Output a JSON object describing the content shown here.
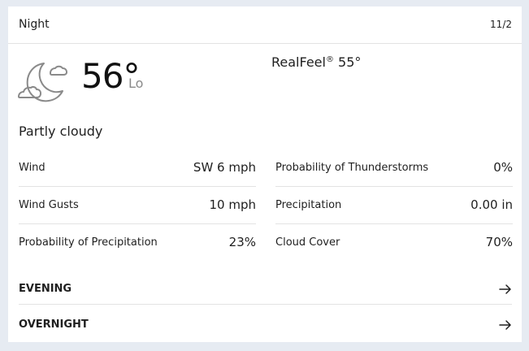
{
  "header": {
    "title": "Night",
    "date": "11/2"
  },
  "current": {
    "icon": "moon-cloud-icon",
    "temperature": "56°",
    "temperature_label": "Lo",
    "realfeel_label": "RealFeel",
    "realfeel_mark": "®",
    "realfeel_value": "55°",
    "phrase": "Partly cloudy"
  },
  "details": {
    "left": [
      {
        "label": "Wind",
        "value": "SW 6 mph"
      },
      {
        "label": "Wind Gusts",
        "value": "10 mph"
      },
      {
        "label": "Probability of Precipitation",
        "value": "23%"
      }
    ],
    "right": [
      {
        "label": "Probability of Thunderstorms",
        "value": "0%"
      },
      {
        "label": "Precipitation",
        "value": "0.00 in"
      },
      {
        "label": "Cloud Cover",
        "value": "70%"
      }
    ]
  },
  "links": [
    {
      "label": "EVENING",
      "icon": "arrow-right-icon"
    },
    {
      "label": "OVERNIGHT",
      "icon": "arrow-right-icon"
    }
  ]
}
